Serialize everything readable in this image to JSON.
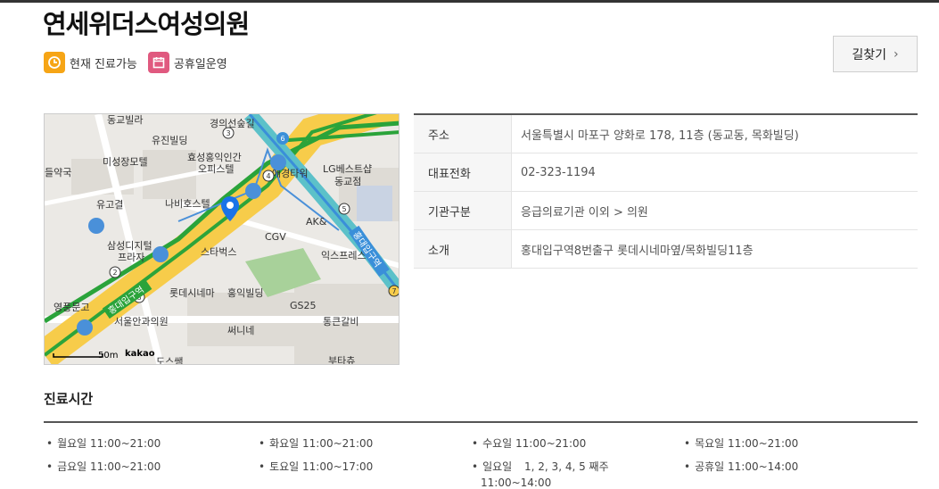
{
  "clinic": {
    "name": "연세위더스여성의원"
  },
  "badges": [
    {
      "label": "현재 진료가능",
      "icon": "clock-icon",
      "color": "#f6a516"
    },
    {
      "label": "공휴일운영",
      "icon": "calendar-icon",
      "color": "#e0597f"
    }
  ],
  "route_button": {
    "label": "길찾기",
    "icon": "chevron-right-icon"
  },
  "map": {
    "labels": {
      "gyoyo_villa": "동교빌라",
      "gyeongui_line": "경의선숲길",
      "yujin": "유진빌딩",
      "misung": "미성장모텔",
      "hyosung": "효성홍익인간",
      "officetel": "오피스텔",
      "aekyung": "애경타워",
      "lg": "LG베스트샵",
      "donggyo_store": "동교점",
      "pharmacy": "들약국",
      "yugogyeol": "유고결",
      "nabi": "나비호스텔",
      "ak": "AK&",
      "samsung": "삼성디지털",
      "plaza": "프라자",
      "starbucks": "스타벅스",
      "cgv": "CGV",
      "hongdae_station": "홍대입구역",
      "express": "익스프레스",
      "lottecinema": "롯데시네마",
      "hongik_bldg": "홍익빌딩",
      "youngpoong": "영풍문고",
      "gs25": "GS25",
      "seoul_surgery": "서울안과의원",
      "tongkeun": "통큰갈비",
      "sunny": "써니네",
      "butachu": "부타츄",
      "dosubaek": "도스쌤",
      "scale": "50m",
      "provider": "kakao",
      "line_label": "홍대입구역"
    }
  },
  "info": {
    "rows": [
      {
        "key": "주소",
        "value": "서울특별시 마포구 양화로 178, 11층 (동교동, 목화빌딩)"
      },
      {
        "key": "대표전화",
        "value": "02-323-1194"
      },
      {
        "key": "기관구분",
        "value": "응급의료기관 이외 > 의원"
      },
      {
        "key": "소개",
        "value": "홍대입구역8번출구 롯데시네마옆/목화빌딩11층"
      }
    ]
  },
  "hours": {
    "title": "진료시간",
    "items": [
      {
        "day": "월요일",
        "time": "11:00~21:00"
      },
      {
        "day": "화요일",
        "time": "11:00~21:00"
      },
      {
        "day": "수요일",
        "time": "11:00~21:00"
      },
      {
        "day": "목요일",
        "time": "11:00~21:00"
      },
      {
        "day": "금요일",
        "time": "11:00~21:00"
      },
      {
        "day": "토요일",
        "time": "11:00~17:00"
      },
      {
        "day": "일요일",
        "time": "1, 2, 3, 4, 5 째주",
        "time2": "11:00~14:00"
      },
      {
        "day": "공휴일",
        "time": "11:00~14:00"
      }
    ]
  }
}
